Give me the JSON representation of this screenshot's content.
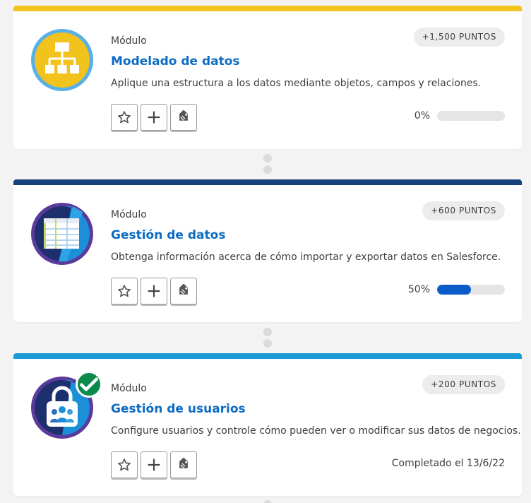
{
  "modules": [
    {
      "eyebrow": "Módulo",
      "title": "Modelado de datos",
      "description": "Aplique una estructura a los datos mediante objetos, campos y relaciones.",
      "points": "+1,500 PUNTOS",
      "progress_label": "0%",
      "progress": 0,
      "accent_color": "#f2c31c",
      "badge_icon": "hierarchy-icon",
      "completed": false
    },
    {
      "eyebrow": "Módulo",
      "title": "Gestión de datos",
      "description": "Obtenga información acerca de cómo importar y exportar datos en Salesforce.",
      "points": "+600 PUNTOS",
      "progress_label": "50%",
      "progress": 0.5,
      "accent_color": "#16437e",
      "badge_icon": "spreadsheet-icon",
      "completed": false
    },
    {
      "eyebrow": "Módulo",
      "title": "Gestión de usuarios",
      "description": "Configure usuarios y controle cómo pueden ver o modificar sus datos de negocios.",
      "points": "+200 PUNTOS",
      "completed_label": "Completado el 13/6/22",
      "accent_color": "#1a9ad6",
      "badge_icon": "user-lock-icon",
      "completed": true
    }
  ],
  "actions": [
    "star-icon",
    "plus-icon",
    "tag-icon"
  ]
}
